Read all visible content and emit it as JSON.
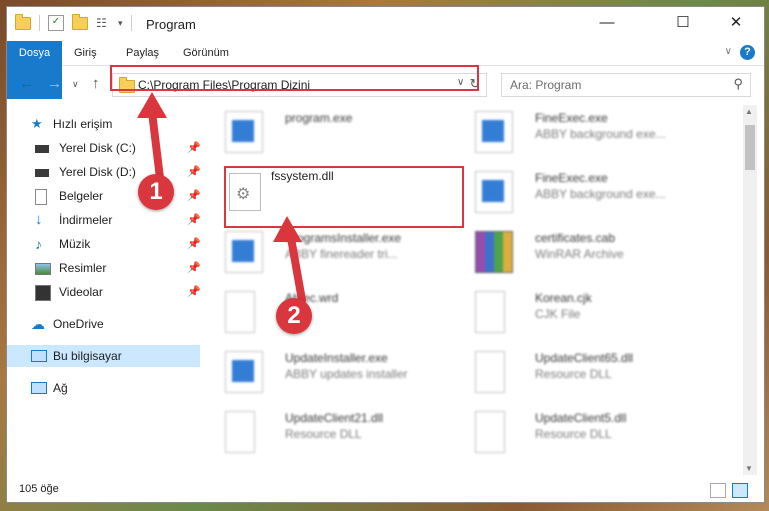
{
  "window": {
    "title": "Program"
  },
  "ribbon": {
    "tabs": [
      "Dosya",
      "Giriş",
      "Paylaş",
      "Görünüm"
    ],
    "help_label": "?"
  },
  "address": {
    "path": "C:\\Program Files\\Program Dizini"
  },
  "search": {
    "placeholder": "Ara: Program"
  },
  "nav": {
    "quick_access": "Hızlı erişim",
    "items": [
      {
        "label": "Yerel Disk (C:)",
        "pinned": true
      },
      {
        "label": "Yerel Disk (D:)",
        "pinned": true
      },
      {
        "label": "Belgeler",
        "pinned": true
      },
      {
        "label": "İndirmeler",
        "pinned": true
      },
      {
        "label": "Müzik",
        "pinned": true
      },
      {
        "label": "Resimler",
        "pinned": true
      },
      {
        "label": "Videolar",
        "pinned": true
      }
    ],
    "onedrive": "OneDrive",
    "this_pc": "Bu bilgisayar",
    "network": "Ağ"
  },
  "files": [
    {
      "name": "program.exe",
      "desc": ""
    },
    {
      "name": "FineExec.exe",
      "desc": "ABBY background exe..."
    },
    {
      "name": "fssystem.dll",
      "desc": ""
    },
    {
      "name": "FineExec.exe",
      "desc": "ABBY background exe..."
    },
    {
      "name": "ProgramsInstaller.exe",
      "desc": "ABBY finereader tri..."
    },
    {
      "name": "certificates.cab",
      "desc": "WinRAR Archive"
    },
    {
      "name": "Abtec.wrd",
      "desc": ""
    },
    {
      "name": "Korean.cjk",
      "desc": "CJK File"
    },
    {
      "name": "UpdateInstaller.exe",
      "desc": "ABBY updates installer"
    },
    {
      "name": "UpdateClient65.dll",
      "desc": "Resource DLL"
    },
    {
      "name": "UpdateClient21.dll",
      "desc": "Resource DLL"
    },
    {
      "name": "UpdateClient5.dll",
      "desc": "Resource DLL"
    }
  ],
  "status": {
    "count": "105 öğe"
  },
  "annotations": {
    "step1": "1",
    "step2": "2"
  },
  "colors": {
    "highlight": "#d9363e",
    "accent": "#1979ca",
    "selected": "#cce8ff"
  }
}
